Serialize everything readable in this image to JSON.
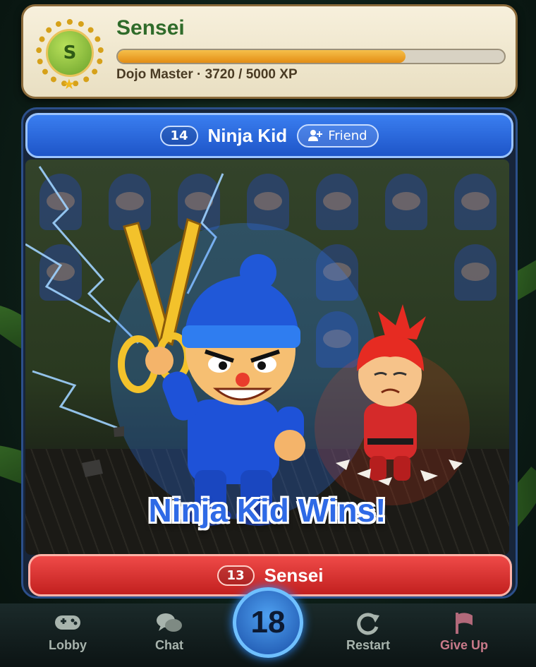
{
  "player": {
    "avatar_letter": "S",
    "name": "Sensei",
    "rank_xp": "Dojo Master · 3720 / 5000 XP",
    "xp_current": 3720,
    "xp_max": 5000
  },
  "opponent": {
    "level": "14",
    "name": "Ninja Kid",
    "friend_label": "Friend"
  },
  "result_text": "Ninja Kid Wins!",
  "self": {
    "level": "13",
    "name": "Sensei"
  },
  "timer": "18",
  "nav": {
    "lobby": "Lobby",
    "chat": "Chat",
    "restart": "Restart",
    "give_up": "Give Up"
  },
  "colors": {
    "opponent_banner": "#2f6ae6",
    "self_banner": "#d9302e",
    "xp_fill": "#eea22c",
    "give_up": "#c97a8a"
  }
}
